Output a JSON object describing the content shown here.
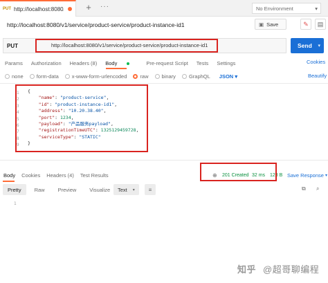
{
  "tab": {
    "method": "PUT",
    "title": "http://localhost:8080/v",
    "close_icon": "close-icon",
    "add_icon": "plus-icon",
    "more_icon": "ellipsis-icon"
  },
  "environment": {
    "label": "No Environment",
    "chevron_icon": "chevron-down-icon"
  },
  "request": {
    "title": "http://localhost:8080/v1/service/product-service/product-instance-id1",
    "save_label": "Save",
    "method": "PUT",
    "url": "http://localhost:8080/v1/service/product-service/product-instance-id1",
    "send_label": "Send"
  },
  "request_tabs": [
    {
      "label": "Params",
      "active": false
    },
    {
      "label": "Authorization",
      "active": false
    },
    {
      "label": "Headers (8)",
      "active": false
    },
    {
      "label": "Body",
      "active": true
    },
    {
      "label": "Pre-request Script",
      "active": false
    },
    {
      "label": "Tests",
      "active": false
    },
    {
      "label": "Settings",
      "active": false
    }
  ],
  "cookies_label": "Cookies",
  "body_types": [
    {
      "label": "none",
      "selected": false
    },
    {
      "label": "form-data",
      "selected": false
    },
    {
      "label": "x-www-form-urlencoded",
      "selected": false
    },
    {
      "label": "raw",
      "selected": true
    },
    {
      "label": "binary",
      "selected": false
    },
    {
      "label": "GraphQL",
      "selected": false
    }
  ],
  "raw_format": "JSON",
  "beautify_label": "Beautify",
  "code_lines": [
    {
      "num": "1",
      "text": "{"
    },
    {
      "num": "2",
      "key": "\"name\"",
      "value": "\"product-service\"",
      "tail": ","
    },
    {
      "num": "3",
      "key": "\"id\"",
      "value": "\"product-instance-id1\"",
      "tail": ","
    },
    {
      "num": "4",
      "key": "\"address\"",
      "value": "\"10.20.38.40\"",
      "tail": ","
    },
    {
      "num": "5",
      "key": "\"port\"",
      "value": "1234",
      "tail": ","
    },
    {
      "num": "6",
      "key": "\"payload\"",
      "value": "\"产品服务payload\"",
      "tail": ","
    },
    {
      "num": "7",
      "key": "\"registrationTimeUTC\"",
      "value": "1325129459728",
      "tail": ","
    },
    {
      "num": "8",
      "key": "\"serviceType\"",
      "value": "\"STATIC\"",
      "tail": ""
    },
    {
      "num": "9",
      "text": "}"
    }
  ],
  "response": {
    "tabs": [
      {
        "label": "Body",
        "active": true
      },
      {
        "label": "Cookies",
        "active": false
      },
      {
        "label": "Headers (4)",
        "active": false
      },
      {
        "label": "Test Results",
        "active": false
      }
    ],
    "status": "201 Created",
    "time": "32 ms",
    "size": "128 B",
    "save_label": "Save Response",
    "view_tabs": [
      {
        "label": "Pretty",
        "active": true
      },
      {
        "label": "Raw",
        "active": false
      },
      {
        "label": "Preview",
        "active": false
      },
      {
        "label": "Visualize",
        "active": false
      }
    ],
    "format": "Text",
    "line_number": "1"
  },
  "watermark": {
    "logo": "知乎",
    "text": "@超哥聊编程"
  },
  "colors": {
    "accent": "#ff6c37",
    "send": "#1a6fd6",
    "highlight": "#d9231f",
    "status_ok": "#0a8f3e"
  }
}
